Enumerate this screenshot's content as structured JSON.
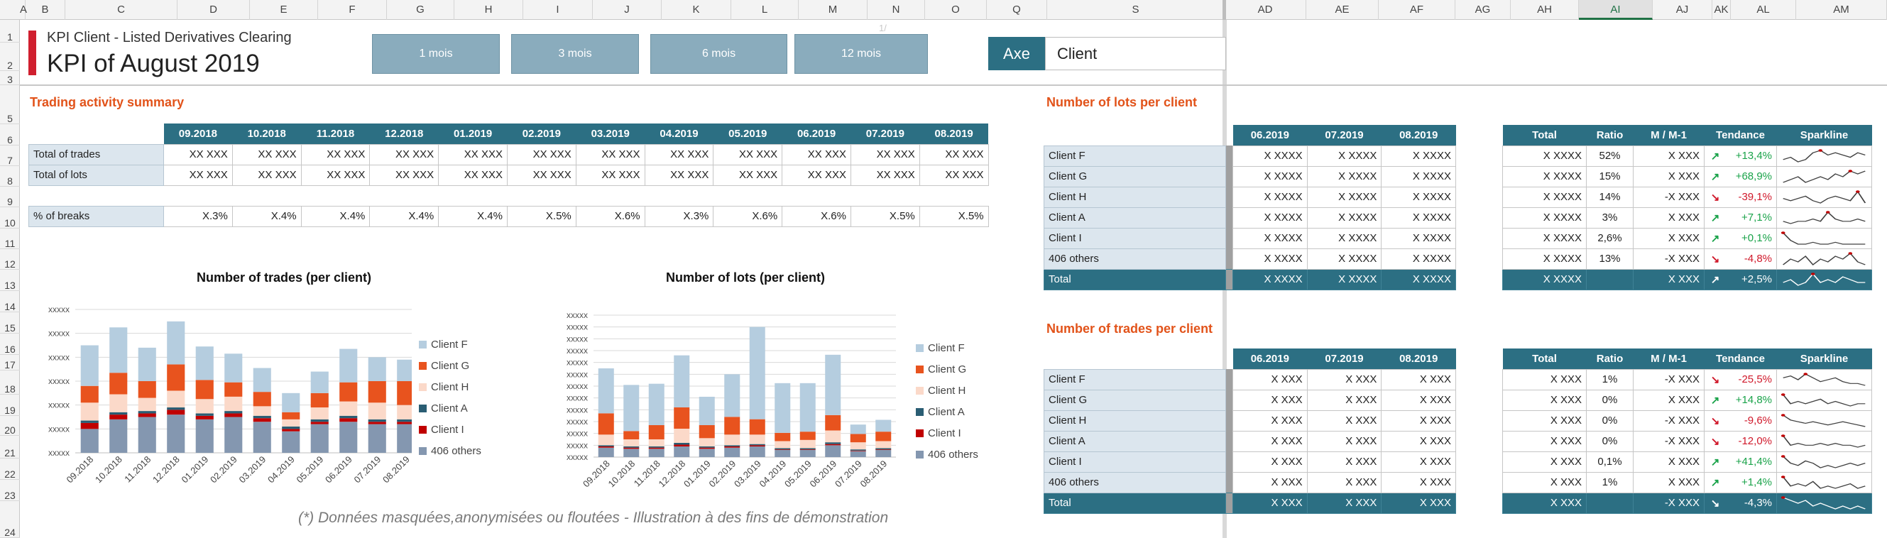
{
  "sheet": {
    "columns": [
      {
        "label": "A"
      },
      {
        "label": "B"
      },
      {
        "label": "C"
      },
      {
        "label": "D"
      },
      {
        "label": "E"
      },
      {
        "label": "F"
      },
      {
        "label": "G"
      },
      {
        "label": "H"
      },
      {
        "label": "I"
      },
      {
        "label": "J"
      },
      {
        "label": "K"
      },
      {
        "label": "L"
      },
      {
        "label": "M"
      },
      {
        "label": "N"
      },
      {
        "label": "O"
      },
      {
        "label": "Q"
      },
      {
        "label": "S"
      },
      {
        "label": "AD"
      },
      {
        "label": "AE"
      },
      {
        "label": "AF"
      },
      {
        "label": "AG"
      },
      {
        "label": "AH"
      },
      {
        "label": "AI",
        "selected": true
      },
      {
        "label": "AJ"
      },
      {
        "label": "AK"
      },
      {
        "label": "AL"
      },
      {
        "label": "AM"
      }
    ],
    "rows": [
      "1",
      "2",
      "3",
      "5",
      "6",
      "7",
      "8",
      "9",
      "10",
      "11",
      "12",
      "13",
      "14",
      "15",
      "16",
      "17",
      "18",
      "19",
      "20",
      "21",
      "22",
      "23",
      "24"
    ],
    "ghost_label": "1/"
  },
  "header": {
    "subtitle": "KPI Client - Listed Derivatives Clearing",
    "title": "KPI of August 2019"
  },
  "period_buttons": [
    {
      "label": "1 mois"
    },
    {
      "label": "3 mois"
    },
    {
      "label": "6 mois"
    },
    {
      "label": "12 mois"
    }
  ],
  "axe": {
    "label": "Axe",
    "value": "Client"
  },
  "trading_summary": {
    "title": "Trading activity summary",
    "months": [
      "09.2018",
      "10.2018",
      "11.2018",
      "12.2018",
      "01.2019",
      "02.2019",
      "03.2019",
      "04.2019",
      "05.2019",
      "06.2019",
      "07.2019",
      "08.2019"
    ],
    "rows": [
      {
        "label": "Total of trades",
        "values": [
          "XX XXX",
          "XX XXX",
          "XX XXX",
          "XX XXX",
          "XX XXX",
          "XX XXX",
          "XX XXX",
          "XX XXX",
          "XX XXX",
          "XX XXX",
          "XX XXX",
          "XX XXX"
        ]
      },
      {
        "label": "Total of lots",
        "values": [
          "XX XXX",
          "XX XXX",
          "XX XXX",
          "XX XXX",
          "XX XXX",
          "XX XXX",
          "XX XXX",
          "XX XXX",
          "XX XXX",
          "XX XXX",
          "XX XXX",
          "XX XXX"
        ]
      }
    ],
    "breaks": {
      "label": "% of breaks",
      "values": [
        "X.3%",
        "X.4%",
        "X.4%",
        "X.4%",
        "X.4%",
        "X.5%",
        "X.6%",
        "X.3%",
        "X.6%",
        "X.6%",
        "X.5%",
        "X.5%"
      ]
    }
  },
  "lots_per_client": {
    "title": "Number of lots per client",
    "months": [
      "06.2019",
      "07.2019",
      "08.2019"
    ],
    "stats_headers": [
      "Total",
      "Ratio",
      "M / M-1",
      "Tendance",
      "Sparkline"
    ],
    "rows": [
      {
        "client": "Client F",
        "m": [
          "X XXXX",
          "X XXXX",
          "X XXXX"
        ],
        "total": "X XXXX",
        "ratio": "52%",
        "mm1": "X XXX",
        "trend": "up",
        "trend_value": "+13,4%",
        "spark": [
          5,
          6,
          4,
          5,
          8,
          9,
          7,
          8,
          7,
          6,
          8,
          7
        ]
      },
      {
        "client": "Client G",
        "m": [
          "X XXXX",
          "X XXXX",
          "X XXXX"
        ],
        "total": "X XXXX",
        "ratio": "15%",
        "mm1": "X XXX",
        "trend": "up",
        "trend_value": "+68,9%",
        "spark": [
          4,
          5,
          6,
          4,
          5,
          6,
          5,
          7,
          6,
          8,
          7,
          8
        ]
      },
      {
        "client": "Client H",
        "m": [
          "X XXXX",
          "X XXXX",
          "X XXXX"
        ],
        "total": "X XXXX",
        "ratio": "14%",
        "mm1": "-X XXX",
        "trend": "down",
        "trend_value": "-39,1%",
        "spark": [
          6,
          5,
          6,
          7,
          5,
          4,
          6,
          7,
          6,
          5,
          9,
          4
        ]
      },
      {
        "client": "Client A",
        "m": [
          "X XXXX",
          "X XXXX",
          "X XXXX"
        ],
        "total": "X XXXX",
        "ratio": "3%",
        "mm1": "X XXX",
        "trend": "up",
        "trend_value": "+7,1%",
        "spark": [
          5,
          4,
          5,
          5,
          6,
          5,
          9,
          6,
          5,
          5,
          6,
          5
        ]
      },
      {
        "client": "Client I",
        "m": [
          "X XXXX",
          "X XXXX",
          "X XXXX"
        ],
        "total": "X XXXX",
        "ratio": "2,6%",
        "mm1": "X XXX",
        "trend": "up",
        "trend_value": "+0,1%",
        "spark": [
          9,
          5,
          3,
          3,
          4,
          3,
          3,
          4,
          3,
          3,
          3,
          3
        ]
      },
      {
        "client": "406 others",
        "m": [
          "X XXXX",
          "X XXXX",
          "X XXXX"
        ],
        "total": "X XXXX",
        "ratio": "13%",
        "mm1": "-X XXX",
        "trend": "down",
        "trend_value": "-4,8%",
        "spark": [
          4,
          6,
          5,
          7,
          4,
          6,
          5,
          7,
          6,
          8,
          5,
          4
        ]
      }
    ],
    "total": {
      "label": "Total",
      "m": [
        "X XXXX",
        "X XXXX",
        "X XXXX"
      ],
      "total": "X XXXX",
      "ratio": "",
      "mm1": "X XXX",
      "trend": "up",
      "trend_value": "+2,5%",
      "spark": [
        5,
        6,
        4,
        5,
        8,
        5,
        6,
        5,
        7,
        6,
        5,
        5
      ]
    }
  },
  "trades_per_client": {
    "title": "Number of trades per client",
    "months": [
      "06.2019",
      "07.2019",
      "08.2019"
    ],
    "stats_headers": [
      "Total",
      "Ratio",
      "M / M-1",
      "Tendance",
      "Sparkline"
    ],
    "rows": [
      {
        "client": "Client F",
        "m": [
          "X XXX",
          "X XXX",
          "X XXX"
        ],
        "total": "X XXX",
        "ratio": "1%",
        "mm1": "-X XXX",
        "trend": "down",
        "trend_value": "-25,5%",
        "spark": [
          7,
          8,
          6,
          9,
          7,
          5,
          6,
          7,
          5,
          4,
          4,
          3
        ]
      },
      {
        "client": "Client G",
        "m": [
          "X XXX",
          "X XXX",
          "X XXX"
        ],
        "total": "X XXX",
        "ratio": "0%",
        "mm1": "X XXX",
        "trend": "up",
        "trend_value": "+14,8%",
        "spark": [
          9,
          5,
          6,
          5,
          6,
          7,
          5,
          6,
          5,
          4,
          5,
          5
        ]
      },
      {
        "client": "Client H",
        "m": [
          "X XXX",
          "X XXX",
          "X XXX"
        ],
        "total": "X XXX",
        "ratio": "0%",
        "mm1": "-X XXX",
        "trend": "down",
        "trend_value": "-9,6%",
        "spark": [
          9,
          6,
          5,
          4,
          5,
          4,
          3,
          4,
          5,
          4,
          3,
          2
        ]
      },
      {
        "client": "Client A",
        "m": [
          "X XXX",
          "X XXX",
          "X XXX"
        ],
        "total": "X XXX",
        "ratio": "0%",
        "mm1": "-X XXX",
        "trend": "down",
        "trend_value": "-12,0%",
        "spark": [
          9,
          4,
          5,
          4,
          4,
          5,
          4,
          5,
          4,
          4,
          3,
          4
        ]
      },
      {
        "client": "Client I",
        "m": [
          "X XXX",
          "X XXX",
          "X XXX"
        ],
        "total": "X XXX",
        "ratio": "0,1%",
        "mm1": "X XXX",
        "trend": "up",
        "trend_value": "+41,4%",
        "spark": [
          8,
          5,
          4,
          6,
          5,
          3,
          4,
          3,
          4,
          5,
          4,
          5
        ]
      },
      {
        "client": "406 others",
        "m": [
          "X XXX",
          "X XXX",
          "X XXX"
        ],
        "total": "X XXX",
        "ratio": "1%",
        "mm1": "X XXX",
        "trend": "up",
        "trend_value": "+1,4%",
        "spark": [
          9,
          5,
          6,
          5,
          7,
          4,
          5,
          4,
          5,
          6,
          4,
          5
        ]
      }
    ],
    "total": {
      "label": "Total",
      "m": [
        "X XXX",
        "X XXX",
        "X XXX"
      ],
      "total": "X XXX",
      "ratio": "",
      "mm1": "-X XXX",
      "trend": "down",
      "trend_value": "-4,3%",
      "spark": [
        8,
        7,
        6,
        7,
        5,
        6,
        5,
        4,
        5,
        4,
        5,
        4
      ]
    }
  },
  "chart_data": [
    {
      "type": "bar",
      "stacked": true,
      "title": "Number of trades (per client)",
      "categories": [
        "09.2018",
        "10.2018",
        "11.2018",
        "12.2018",
        "01.2019",
        "02.2019",
        "03.2019",
        "04.2019",
        "05.2019",
        "06.2019",
        "07.2019",
        "08.2019"
      ],
      "y_tick_labels": [
        "xxxxx",
        "xxxxx",
        "xxxxx",
        "xxxxx",
        "xxxxx",
        "xxxxx",
        "xxxxx"
      ],
      "ylim": [
        0,
        6
      ],
      "grid": true,
      "legend_position": "right",
      "series": [
        {
          "name": "406 others",
          "color": "#8497b0",
          "values": [
            1.0,
            1.4,
            1.5,
            1.6,
            1.4,
            1.5,
            1.3,
            0.9,
            1.2,
            1.3,
            1.2,
            1.2
          ]
        },
        {
          "name": "Client I",
          "color": "#c00000",
          "values": [
            0.25,
            0.2,
            0.15,
            0.2,
            0.15,
            0.15,
            0.15,
            0.1,
            0.1,
            0.15,
            0.1,
            0.1
          ]
        },
        {
          "name": "Client A",
          "color": "#2a5d73",
          "values": [
            0.1,
            0.1,
            0.1,
            0.1,
            0.1,
            0.1,
            0.1,
            0.1,
            0.1,
            0.1,
            0.1,
            0.1
          ]
        },
        {
          "name": "Client H",
          "color": "#fbd9c9",
          "values": [
            0.75,
            0.75,
            0.55,
            0.7,
            0.6,
            0.6,
            0.4,
            0.3,
            0.5,
            0.6,
            0.7,
            0.6
          ]
        },
        {
          "name": "Client G",
          "color": "#e8531e",
          "values": [
            0.7,
            0.9,
            0.7,
            1.1,
            0.8,
            0.6,
            0.6,
            0.3,
            0.6,
            0.8,
            0.9,
            1.0
          ]
        },
        {
          "name": "Client F",
          "color": "#b5cddf",
          "values": [
            1.7,
            1.9,
            1.4,
            1.8,
            1.4,
            1.2,
            1.0,
            0.8,
            0.9,
            1.4,
            1.0,
            0.9
          ]
        }
      ]
    },
    {
      "type": "bar",
      "stacked": true,
      "title": "Number of lots (per client)",
      "categories": [
        "09.2018",
        "10.2018",
        "11.2018",
        "12.2018",
        "01.2019",
        "02.2019",
        "03.2019",
        "04.2019",
        "05.2019",
        "06.2019",
        "07.2019",
        "08.2019"
      ],
      "y_tick_labels": [
        "xxxxx",
        "xxxxx",
        "xxxxx",
        "xxxxx",
        "xxxxx",
        "xxxxx",
        "xxxxx",
        "xxxxx",
        "xxxxx",
        "xxxxx",
        "xxxxx",
        "xxxxx",
        "xxxxx"
      ],
      "ylim": [
        0,
        12
      ],
      "grid": true,
      "legend_position": "right",
      "series": [
        {
          "name": "406 others",
          "color": "#8497b0",
          "values": [
            0.8,
            0.7,
            0.7,
            0.9,
            0.7,
            0.8,
            0.9,
            0.6,
            0.6,
            1.0,
            0.5,
            0.6
          ]
        },
        {
          "name": "Client I",
          "color": "#c00000",
          "values": [
            0.1,
            0.1,
            0.1,
            0.15,
            0.1,
            0.1,
            0.1,
            0.05,
            0.05,
            0.1,
            0.05,
            0.05
          ]
        },
        {
          "name": "Client A",
          "color": "#2a5d73",
          "values": [
            0.1,
            0.1,
            0.1,
            0.15,
            0.1,
            0.1,
            0.1,
            0.1,
            0.1,
            0.15,
            0.1,
            0.1
          ]
        },
        {
          "name": "Client H",
          "color": "#fbd9c9",
          "values": [
            0.9,
            0.6,
            0.6,
            1.2,
            0.7,
            0.9,
            0.8,
            0.6,
            0.7,
            1.0,
            0.6,
            0.6
          ]
        },
        {
          "name": "Client G",
          "color": "#e8531e",
          "values": [
            1.8,
            0.7,
            1.2,
            1.8,
            1.1,
            1.5,
            1.3,
            0.7,
            0.7,
            1.3,
            0.7,
            0.8
          ]
        },
        {
          "name": "Client F",
          "color": "#b5cddf",
          "values": [
            3.8,
            3.9,
            3.5,
            4.4,
            2.4,
            3.6,
            7.8,
            4.2,
            4.1,
            5.1,
            0.8,
            1.0
          ]
        }
      ]
    }
  ],
  "footnote": "(*) Données masquées,anonymisées ou floutées - Illustration à des fins de démonstration"
}
